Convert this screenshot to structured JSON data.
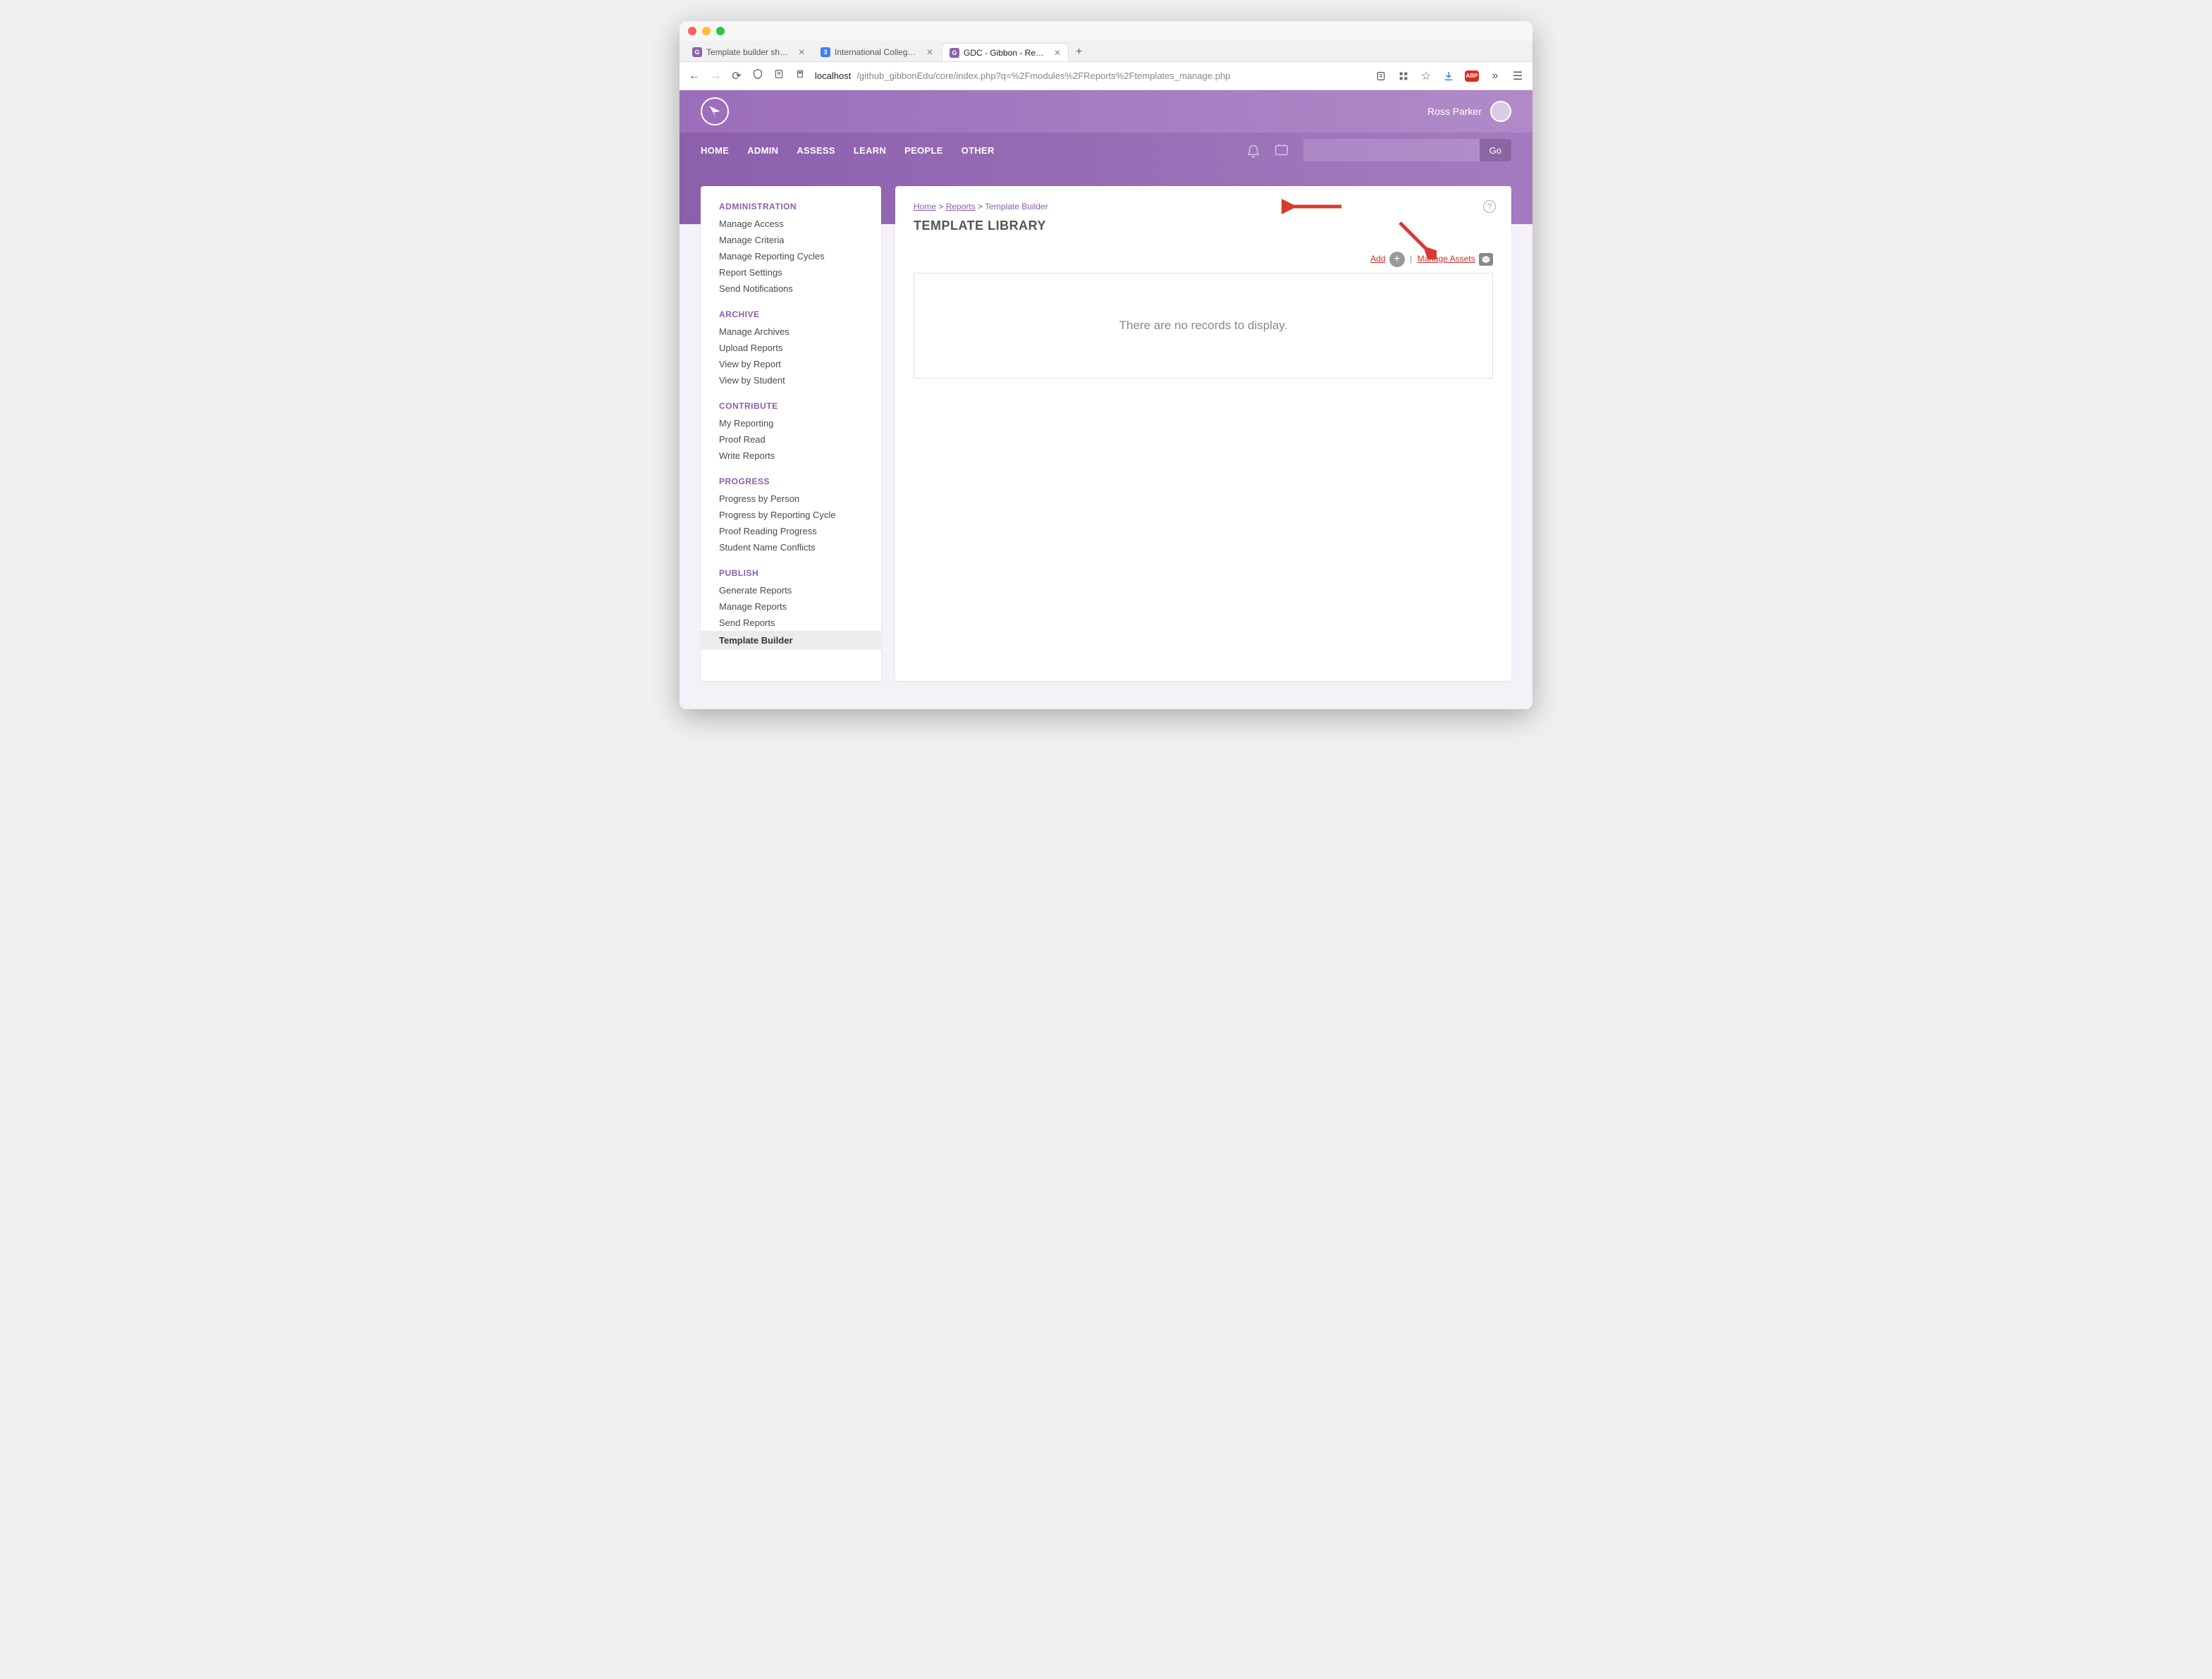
{
  "browser": {
    "tabs": [
      {
        "label": "Template builder show no core c",
        "icon": "G",
        "iconbg": "#8c5fab"
      },
      {
        "label": "International College Hong Kong",
        "icon": "3",
        "iconbg": "#3b82f6"
      },
      {
        "label": "GDC - Gibbon - Reports",
        "icon": "G",
        "iconbg": "#8c5fab",
        "active": true
      }
    ],
    "url_host": "localhost",
    "url_path": "/github_gibbonEdu/core/index.php?q=%2Fmodules%2FReports%2Ftemplates_manage.php"
  },
  "user": {
    "name": "Ross Parker"
  },
  "nav": {
    "items": [
      "HOME",
      "ADMIN",
      "ASSESS",
      "LEARN",
      "PEOPLE",
      "OTHER"
    ],
    "go": "Go"
  },
  "sidebar": [
    {
      "title": "ADMINISTRATION",
      "items": [
        "Manage Access",
        "Manage Criteria",
        "Manage Reporting Cycles",
        "Report Settings",
        "Send Notifications"
      ]
    },
    {
      "title": "ARCHIVE",
      "items": [
        "Manage Archives",
        "Upload Reports",
        "View by Report",
        "View by Student"
      ]
    },
    {
      "title": "CONTRIBUTE",
      "items": [
        "My Reporting",
        "Proof Read",
        "Write Reports"
      ]
    },
    {
      "title": "PROGRESS",
      "items": [
        "Progress by Person",
        "Progress by Reporting Cycle",
        "Proof Reading Progress",
        "Student Name Conflicts"
      ]
    },
    {
      "title": "PUBLISH",
      "items": [
        "Generate Reports",
        "Manage Reports",
        "Send Reports",
        "Template Builder"
      ],
      "active": "Template Builder"
    }
  ],
  "breadcrumb": {
    "home": "Home",
    "reports": "Reports",
    "current": "Template Builder",
    "sep": ">"
  },
  "page": {
    "title": "TEMPLATE LIBRARY",
    "add": "Add",
    "manage_assets": "Manage Assets",
    "empty": "There are no records to display."
  }
}
